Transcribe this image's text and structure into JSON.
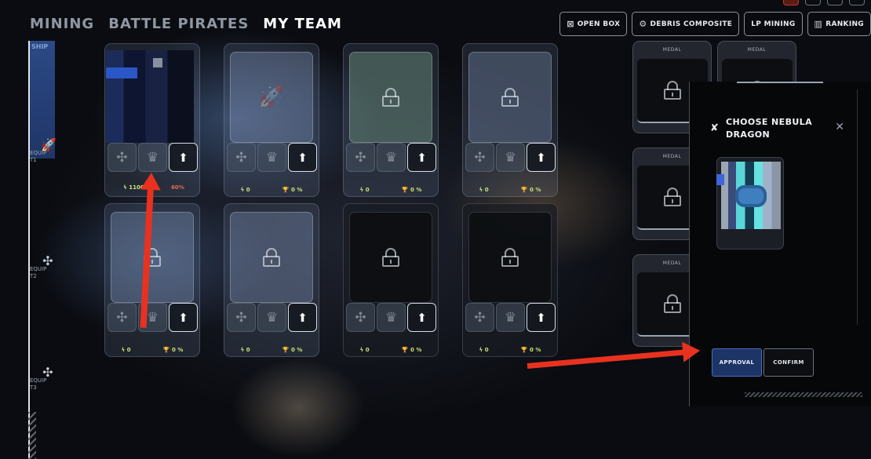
{
  "nav": {
    "mining": "MINING",
    "battle_pirates": "BATTLE PIRATES",
    "my_team": "MY TEAM"
  },
  "toolbar": {
    "open_box": "OPEN BOX",
    "debris_composite": "DEBRIS COMPOSITE",
    "lp_mining": "LP MINING",
    "ranking": "RANKING"
  },
  "sidebar": {
    "tab_label": "SHIP",
    "groups": [
      {
        "label": "EQUIP T1"
      },
      {
        "label": "EQUIP T2"
      },
      {
        "label": "EQUIP T3"
      }
    ]
  },
  "cards": [
    {
      "power": "1100",
      "rate": "60%"
    },
    {
      "power": "0",
      "rate": "0 %"
    },
    {
      "power": "0",
      "rate": "0 %"
    },
    {
      "power": "0",
      "rate": "0 %"
    },
    {
      "power": "0",
      "rate": "0 %"
    },
    {
      "power": "0",
      "rate": "0 %"
    },
    {
      "power": "0",
      "rate": "0 %"
    },
    {
      "power": "0",
      "rate": "0 %"
    }
  ],
  "medals": [
    {
      "label": "MEDAL"
    },
    {
      "label": "MEDAL"
    },
    {
      "label": "MEDAL"
    },
    {
      "label": "MEDAL"
    }
  ],
  "modal": {
    "title": "CHOOSE NEBULA DRAGON",
    "approval_label": "APPROVAL",
    "confirm_label": "CONFIRM"
  },
  "icons": {
    "ship": "rocket-icon",
    "equip": "shuriken-icon",
    "upgrade": "arrow-up-icon",
    "lock": "lock-icon",
    "power": "lightning-icon",
    "trophy": "trophy-icon"
  },
  "colors": {
    "accent_blue": "#1c3466",
    "stat_green": "#c7e37a",
    "annotation_red": "#e8321f"
  }
}
